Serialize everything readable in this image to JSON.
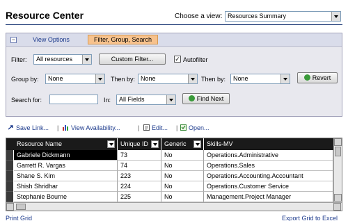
{
  "header": {
    "title": "Resource Center",
    "view_label": "Choose a view:",
    "view_value": "Resources Summary"
  },
  "panel": {
    "tabs": [
      "View Options",
      "Filter, Group, Search"
    ],
    "filter_label": "Filter:",
    "filter_value": "All resources",
    "custom_filter_label": "Custom Filter...",
    "autofilter_label": "Autofilter",
    "autofilter_checked": true,
    "group_by_label": "Group by:",
    "group_by_value": "None",
    "then_by_label_1": "Then by:",
    "then_by_value_1": "None",
    "then_by_label_2": "Then by:",
    "then_by_value_2": "None",
    "revert_label": "Revert",
    "search_label": "Search for:",
    "search_value": "",
    "in_label": "In:",
    "in_value": "All Fields",
    "find_next_label": "Find Next"
  },
  "toolbar": {
    "save_link": "Save Link...",
    "view_availability": "View Availability...",
    "edit": "Edit...",
    "open": "Open..."
  },
  "grid": {
    "columns": [
      "Resource Name",
      "Unique ID",
      "Generic",
      "Skills-MV"
    ],
    "rows": [
      [
        "Gabriele Dickmann",
        "73",
        "No",
        "Operations.Administrative"
      ],
      [
        "Garrett R. Vargas",
        "74",
        "No",
        "Operations.Sales"
      ],
      [
        "Shane S. Kim",
        "223",
        "No",
        "Operations.Accounting.Accountant"
      ],
      [
        "Shish Shridhar",
        "224",
        "No",
        "Operations.Customer Service"
      ],
      [
        "Stephanie Bourne",
        "225",
        "No",
        "Management.Project Manager"
      ]
    ],
    "selected_row": 0
  },
  "footer": {
    "print_grid": "Print Grid",
    "export_grid": "Export Grid to Excel"
  },
  "colors": {
    "link": "#1c3a8c",
    "active_tab": "#f7c28d",
    "grid_header": "#1a1a1a",
    "panel_bg": "#e8e8ee"
  }
}
